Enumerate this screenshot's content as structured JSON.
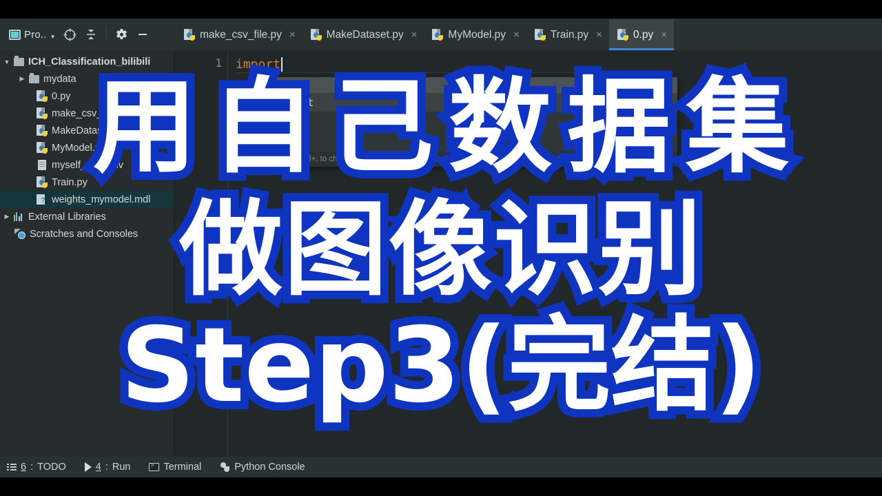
{
  "window": {
    "theme_bg": "#22282a",
    "accent": "#3c87d8",
    "overlay_outline_color": "#0f34bf",
    "overlay_text_color": "#ffffff"
  },
  "toolbar": {
    "panel_chip_label": "Pro..",
    "panel_chip_icon": "project-panel-icon",
    "buttons": [
      {
        "name": "locate-in-tree-icon",
        "tooltip": "Select Opened File"
      },
      {
        "name": "collapse-all-icon",
        "tooltip": "Collapse All"
      },
      {
        "name": "gear-icon",
        "tooltip": "Settings"
      },
      {
        "name": "hide-panel-icon",
        "tooltip": "Hide"
      }
    ]
  },
  "tabs": [
    {
      "label": "make_csv_file.py",
      "icon": "python-file-icon",
      "active": false,
      "close": "×"
    },
    {
      "label": "MakeDataset.py",
      "icon": "python-file-icon",
      "active": false,
      "close": "×"
    },
    {
      "label": "MyModel.py",
      "icon": "python-file-icon",
      "active": false,
      "close": "×"
    },
    {
      "label": "Train.py",
      "icon": "python-file-icon",
      "active": false,
      "close": "×"
    },
    {
      "label": "0.py",
      "icon": "python-file-icon",
      "active": true,
      "close": "×"
    }
  ],
  "sidebar": {
    "scrollbar": "horizontal-scrollbar",
    "tree": [
      {
        "label": "ICH_Classification_bilibili",
        "icon": "folder-icon",
        "indent": 0,
        "arrow": "open",
        "bold": true,
        "selected": false
      },
      {
        "label": "mydata",
        "icon": "folder-icon",
        "indent": 1,
        "arrow": "closed",
        "bold": false,
        "selected": false
      },
      {
        "label": "0.py",
        "icon": "python-file-icon",
        "indent": 2,
        "arrow": "none",
        "bold": false,
        "selected": false
      },
      {
        "label": "make_csv_file.py",
        "icon": "python-file-icon",
        "indent": 2,
        "arrow": "none",
        "bold": false,
        "selected": false
      },
      {
        "label": "MakeDataset.py",
        "icon": "python-file-icon",
        "indent": 2,
        "arrow": "none",
        "bold": false,
        "selected": false
      },
      {
        "label": "MyModel.py",
        "icon": "python-file-icon",
        "indent": 2,
        "arrow": "none",
        "bold": false,
        "selected": false
      },
      {
        "label": "myself_data.csv",
        "icon": "text-file-icon",
        "indent": 2,
        "arrow": "none",
        "bold": false,
        "selected": false
      },
      {
        "label": "Train.py",
        "icon": "python-file-icon",
        "indent": 2,
        "arrow": "none",
        "bold": false,
        "selected": false
      },
      {
        "label": "weights_mymodel.mdl",
        "icon": "unknown-file-icon",
        "indent": 2,
        "arrow": "none",
        "bold": false,
        "selected": true
      },
      {
        "label": "External Libraries",
        "icon": "libraries-icon",
        "indent": 0,
        "arrow": "closed",
        "bold": false,
        "selected": false
      },
      {
        "label": "Scratches and Consoles",
        "icon": "scratches-icon",
        "indent": 0,
        "arrow": "none",
        "bold": false,
        "selected": false
      }
    ]
  },
  "editor": {
    "line_numbers": [
      "1"
    ],
    "lines": [
      {
        "keyword": "import",
        "caret": true
      }
    ],
    "autocomplete": {
      "header": "import",
      "items": [
        {
          "label": "import",
          "icon": "keyword-icon"
        },
        {
          "label": "imp",
          "icon": "module-icon"
        }
      ],
      "footer_hint": "Press Ctrl+. to choose the selected (or first) suggestion and insert a dot afterwards"
    }
  },
  "statusbar": [
    {
      "number": "6",
      "label": "TODO",
      "icon": "todo-list-icon"
    },
    {
      "number": "4",
      "label": "Run",
      "icon": "run-play-icon"
    },
    {
      "number": "",
      "label": "Terminal",
      "icon": "terminal-icon"
    },
    {
      "number": "",
      "label": "Python Console",
      "icon": "python-console-icon"
    }
  ],
  "overlay": {
    "line1": "用自己数据集",
    "line2": "做图像识别",
    "line3": "Step3(完结)"
  }
}
